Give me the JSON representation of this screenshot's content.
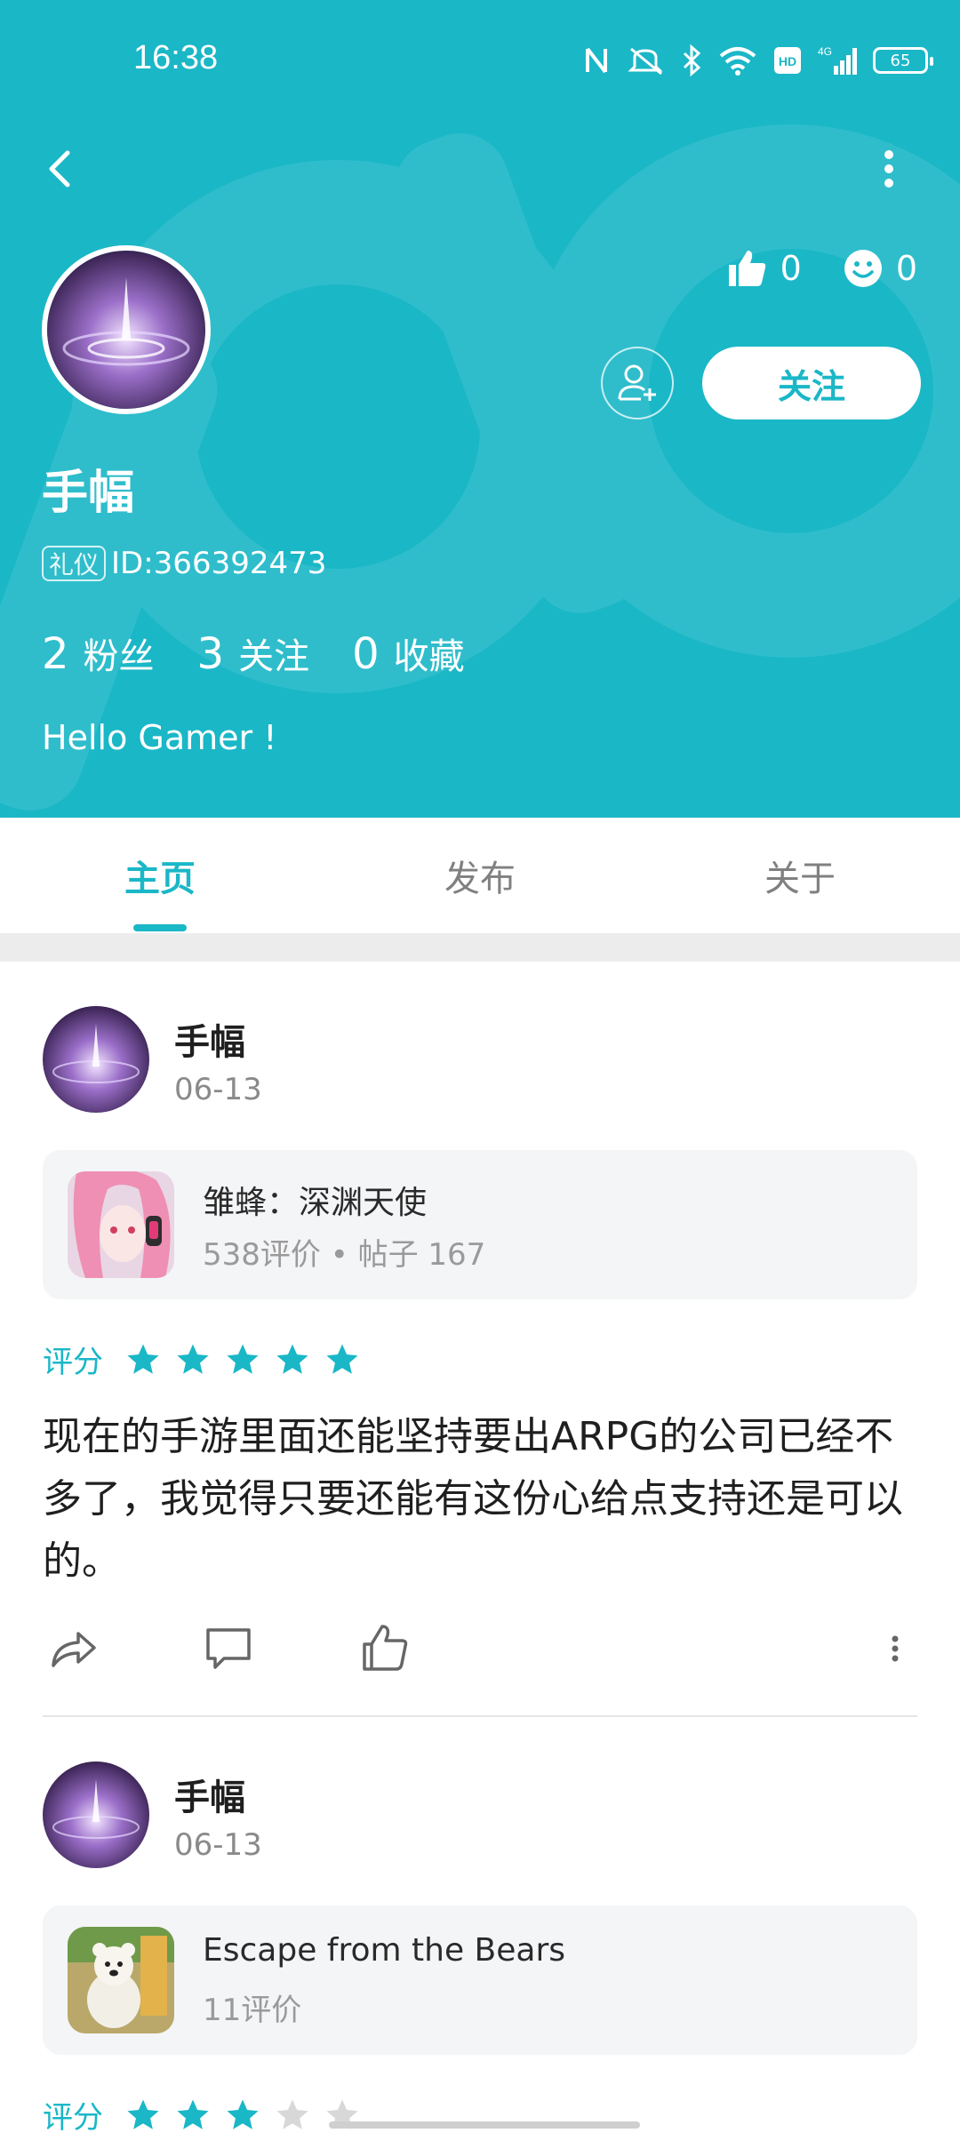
{
  "status_bar": {
    "time": "16:38",
    "battery": "65",
    "icons": [
      "nfc-icon",
      "mute-icon",
      "bluetooth-icon",
      "wifi-icon",
      "hd-icon",
      "signal-4g-icon",
      "battery-icon"
    ]
  },
  "colors": {
    "accent": "#1ab7c7",
    "card_bg": "#f4f5f7",
    "star_off": "#d8d8d8"
  },
  "header": {
    "likes": "0",
    "smiles": "0",
    "follow_label": "关注",
    "user_name": "手幅",
    "id_badge": "礼仪",
    "id_text": "ID:366392473",
    "followers": {
      "count": "2",
      "label": "粉丝"
    },
    "following": {
      "count": "3",
      "label": "关注"
    },
    "favorites": {
      "count": "0",
      "label": "收藏"
    },
    "bio": "Hello Gamer !"
  },
  "tabs": [
    {
      "label": "主页",
      "active": true
    },
    {
      "label": "发布",
      "active": false
    },
    {
      "label": "关于",
      "active": false
    }
  ],
  "posts": [
    {
      "user": "手幅",
      "date": "06-13",
      "game": {
        "title": "雏蜂：深渊天使",
        "meta": "538评价 • 帖子 167"
      },
      "rating_label": "评分",
      "rating": 5,
      "text": "现在的手游里面还能坚持要出ARPG的公司已经不多了，我觉得只要还能有这份心给点支持还是可以的。"
    },
    {
      "user": "手幅",
      "date": "06-13",
      "game": {
        "title": "Escape from the Bears",
        "meta": "11评价"
      },
      "rating_label": "评分",
      "rating": 3
    }
  ]
}
